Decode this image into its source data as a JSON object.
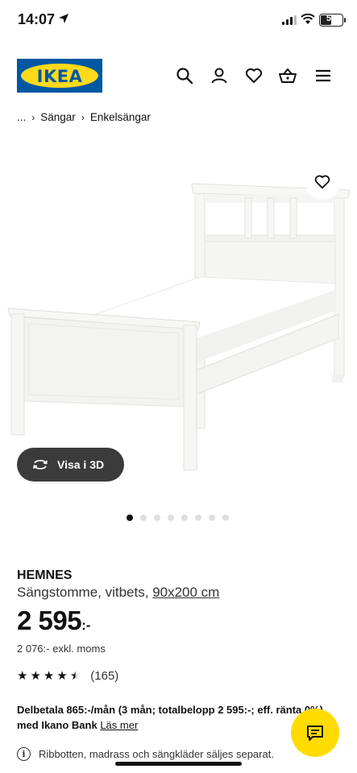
{
  "status_bar": {
    "time": "14:07",
    "battery": "50",
    "battery_level": 0.5
  },
  "header": {
    "logo_text": "IKEA",
    "icons": [
      "search-icon",
      "user-icon",
      "heart-icon",
      "cart-icon",
      "menu-icon"
    ]
  },
  "breadcrumb": {
    "ellipsis": "...",
    "items": [
      "Sängar",
      "Enkelsängar"
    ]
  },
  "gallery": {
    "view_3d_label": "Visa i 3D",
    "image_count": 8,
    "active_index": 0
  },
  "product": {
    "name": "HEMNES",
    "description": "Sängstomme, vitbets, ",
    "dimensions": "90x200 cm",
    "price": "2 595",
    "price_suffix": ":-",
    "excl_vat": "2 076:- exkl. moms",
    "rating": 4.5,
    "reviews": "(165)",
    "installment": "Delbetala 865:-/mån (3 mån; totalbelopp 2 595:-; eff. ränta 0%) med Ikano Bank ",
    "read_more": "Läs mer",
    "info_text": "Ribbotten, madrass och sängkläder säljes separat."
  },
  "colors": {
    "ikea_blue": "#0058a3",
    "ikea_yellow": "#ffda1a",
    "dark_button": "#3b3b3b"
  }
}
